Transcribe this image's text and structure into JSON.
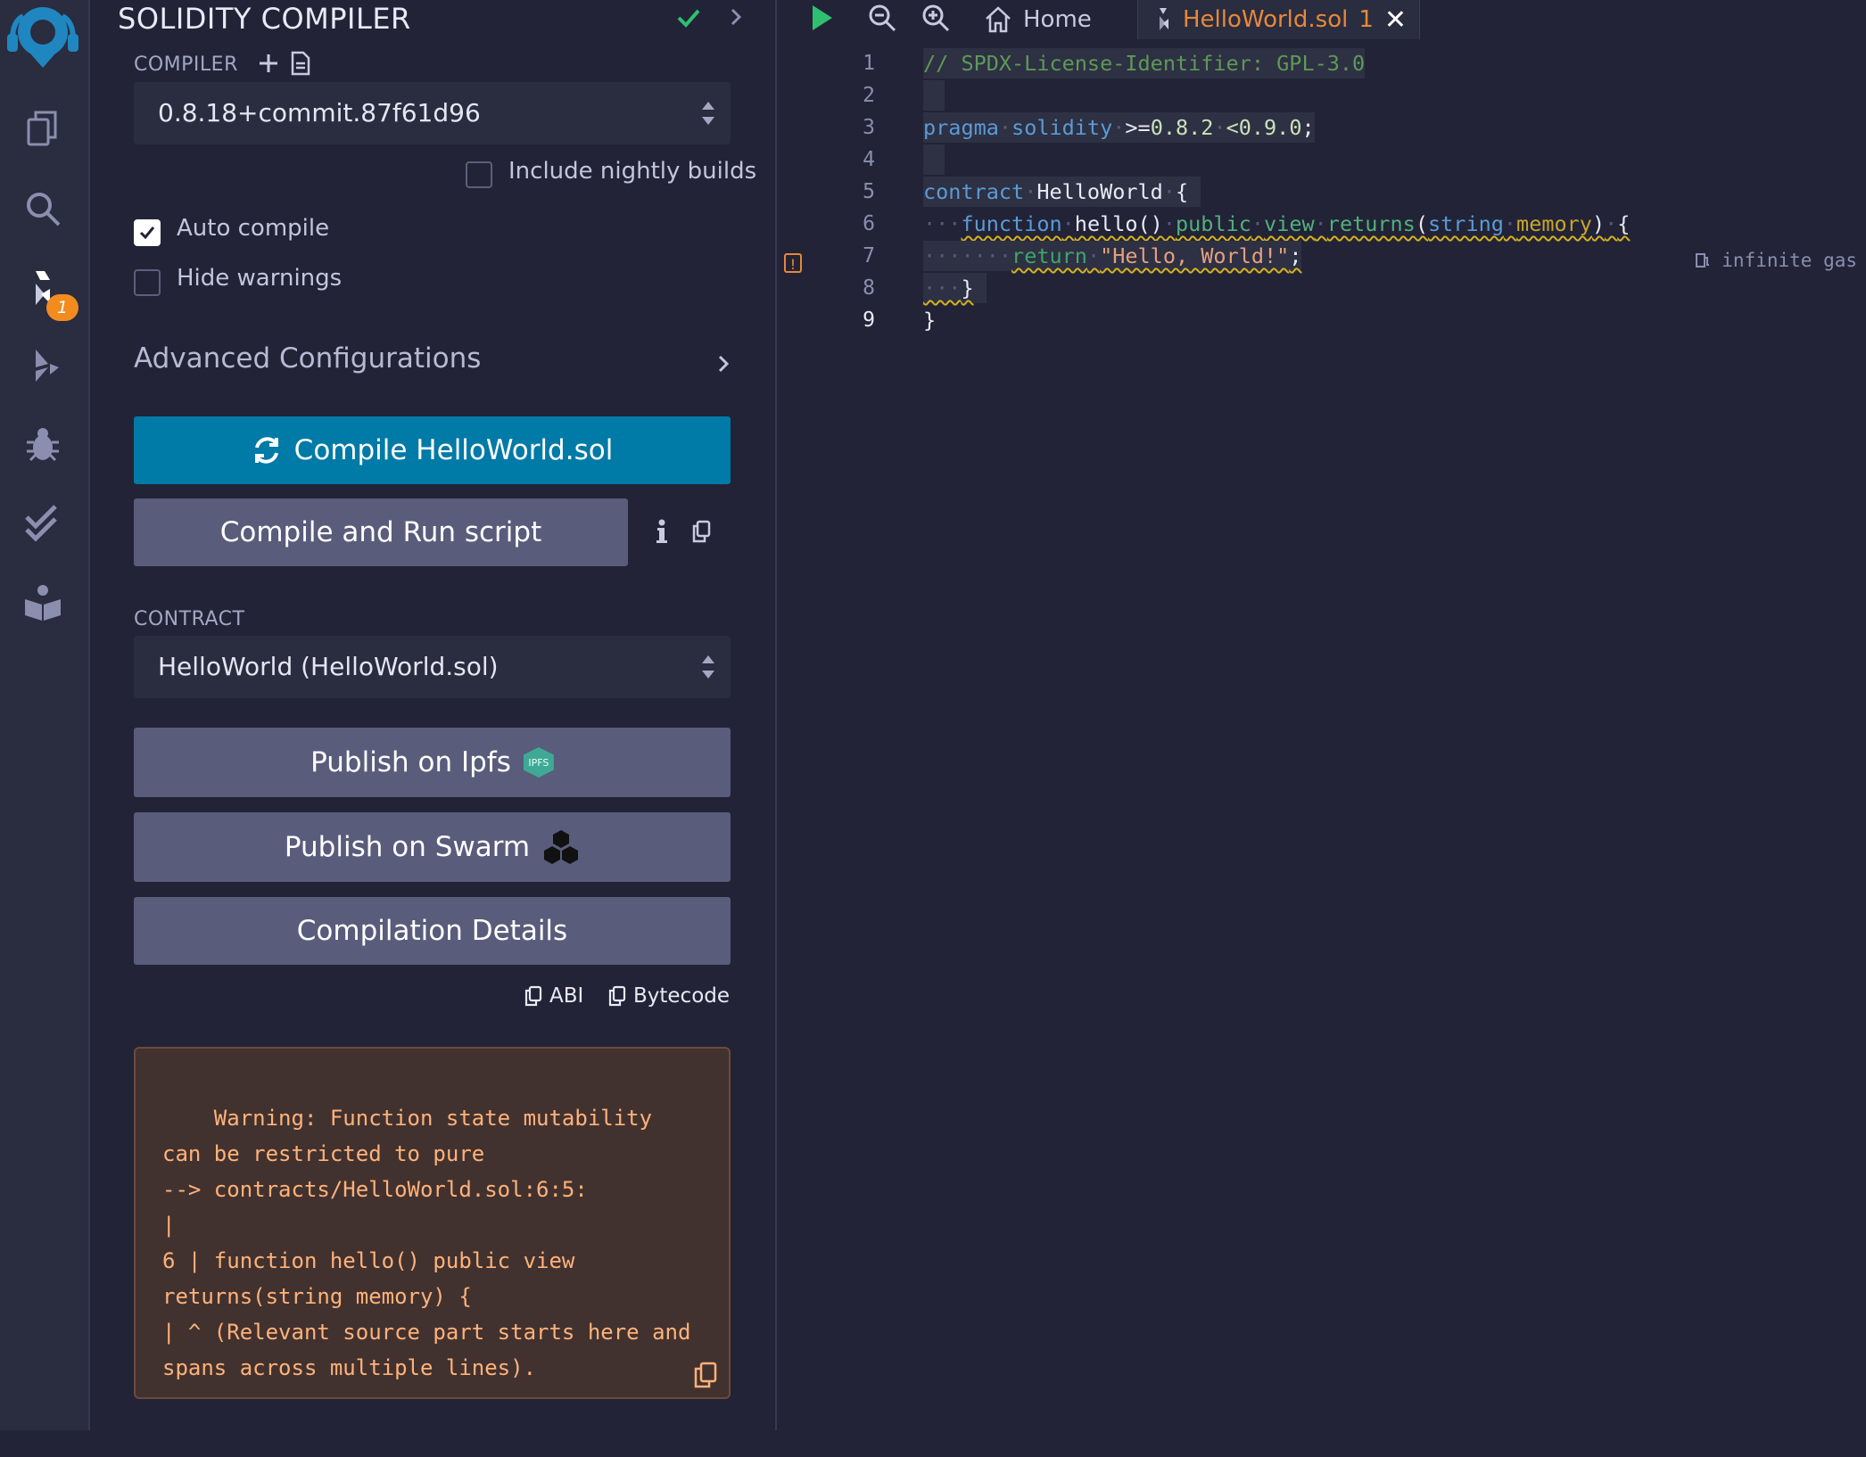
{
  "panel": {
    "title": "SOLIDITY COMPILER",
    "compiler_label": "COMPILER",
    "compiler_version": "0.8.18+commit.87f61d96",
    "include_nightly_label": "Include nightly builds",
    "auto_compile_label": "Auto compile",
    "hide_warnings_label": "Hide warnings",
    "advanced_label": "Advanced Configurations",
    "compile_button": "Compile HelloWorld.sol",
    "compile_run_button": "Compile and Run script",
    "contract_label": "CONTRACT",
    "contract_value": "HelloWorld (HelloWorld.sol)",
    "publish_ipfs": "Publish on Ipfs",
    "ipfs_badge": "IPFS",
    "publish_swarm": "Publish on Swarm",
    "compilation_details": "Compilation Details",
    "abi_label": "ABI",
    "bytecode_label": "Bytecode",
    "warning_text": "Warning: Function state mutability can be restricted to pure\n--> contracts/HelloWorld.sol:6:5:\n|\n6 | function hello() public view returns(string memory) {\n| ^ (Relevant source part starts here and spans across multiple lines)."
  },
  "sidebar": {
    "badge_count": "1",
    "icons": [
      "remix-logo-icon",
      "file-explorer-icon",
      "search-icon",
      "solidity-compiler-icon",
      "deploy-run-icon",
      "debugger-icon",
      "unit-testing-icon",
      "learneth-icon"
    ]
  },
  "editor": {
    "tabs": {
      "home": "Home",
      "file": "HelloWorld.sol",
      "file_count": "1"
    },
    "line_numbers": [
      "1",
      "2",
      "3",
      "4",
      "5",
      "6",
      "7",
      "8",
      "9"
    ],
    "code": {
      "l1": "// SPDX-License-Identifier: GPL-3.0",
      "l3_kw1": "pragma",
      "l3_kw2": "solidity",
      "l3_op": ">=",
      "l3_v1": "0.8.2",
      "l3_v2": "<0.9.0",
      "l3_semi": ";",
      "l5_kw": "contract",
      "l5_name": "HelloWorld",
      "l5_brace": "{",
      "l6_kw": "function",
      "l6_name": "hello()",
      "l6_pub": "public",
      "l6_view": "view",
      "l6_ret": "returns",
      "l6_open": "(",
      "l6_type": "string",
      "l6_mem": "memory",
      "l6_close": ")",
      "l6_brace": "{",
      "l7_kw": "return",
      "l7_str": "\"Hello, World!\"",
      "l7_semi": ";",
      "l8_brace": "}",
      "l9_brace": "}"
    },
    "gas_hint": "infinite gas"
  },
  "colors": {
    "compile_button": "#007aa6",
    "secondary_button": "#595c7a",
    "warning_bg": "#42322f",
    "warning_text": "#ffb27a",
    "tab_active_text": "#e7883a",
    "success": "#2fbf71",
    "badge": "#f28c1f"
  }
}
